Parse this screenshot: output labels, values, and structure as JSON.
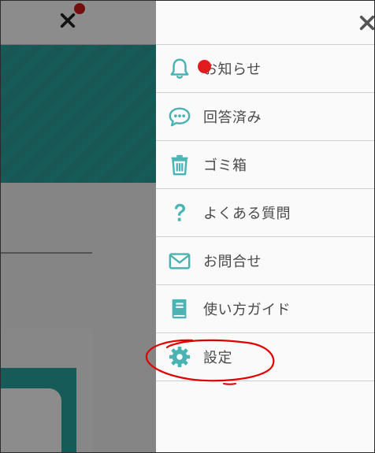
{
  "colors": {
    "accent_teal": "#4bb3b3",
    "badge_red": "#e01c1c",
    "annotation_red": "#e00000",
    "text": "#4a4a4a"
  },
  "menu": {
    "items": [
      {
        "label": "お知らせ",
        "icon": "bell-icon"
      },
      {
        "label": "回答済み",
        "icon": "chat-bubble-icon"
      },
      {
        "label": "ゴミ箱",
        "icon": "trash-icon"
      },
      {
        "label": "よくある質問",
        "icon": "question-icon"
      },
      {
        "label": "お問合せ",
        "icon": "envelope-icon"
      },
      {
        "label": "使い方ガイド",
        "icon": "book-icon"
      },
      {
        "label": "設定",
        "icon": "gear-icon"
      }
    ]
  }
}
